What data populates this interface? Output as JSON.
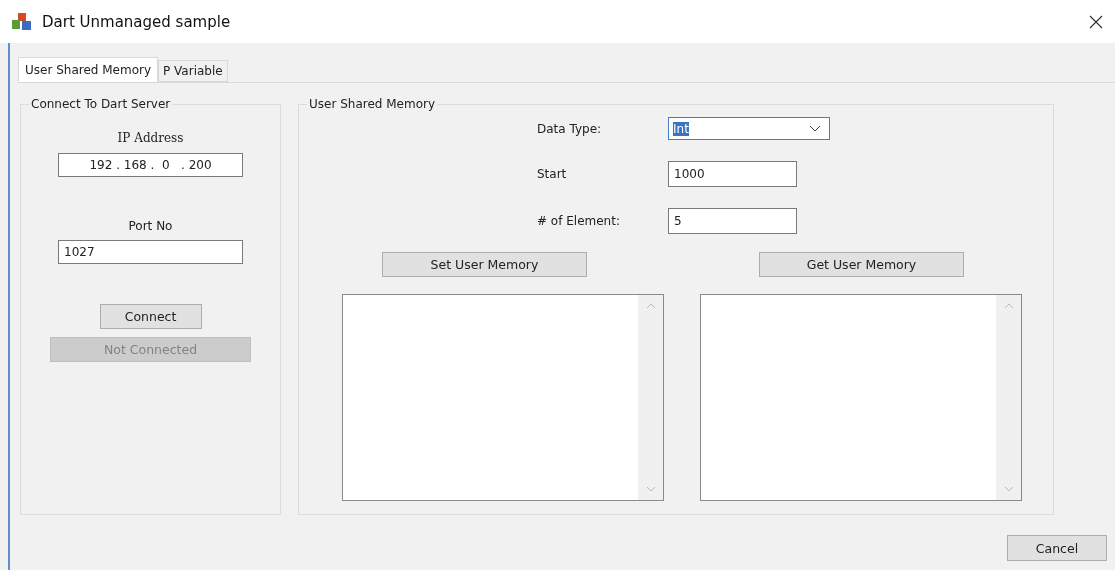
{
  "window": {
    "title": "Dart Unmanaged sample"
  },
  "tabs": [
    {
      "label": "User Shared Memory",
      "selected": true
    },
    {
      "label": "P Variable",
      "selected": false
    }
  ],
  "connect_group": {
    "title": "Connect To Dart Server",
    "ip_label": "IP Address",
    "ip_value": "192 . 168 .  0   . 200",
    "port_label": "Port No",
    "port_value": "1027",
    "connect_button": "Connect",
    "status_button": {
      "label": "Not Connected",
      "disabled": true
    }
  },
  "memory_group": {
    "title": "User Shared Memory",
    "fields": [
      {
        "kind": "combo",
        "label": "Data Type:",
        "value": "Int",
        "text_selected": true
      },
      {
        "kind": "text",
        "label": "Start",
        "value": "1000"
      },
      {
        "kind": "text",
        "label": "# of Element:",
        "value": "5"
      }
    ],
    "buttons": [
      "Set User Memory",
      "Get User Memory"
    ]
  },
  "footer": {
    "cancel_button": "Cancel"
  }
}
